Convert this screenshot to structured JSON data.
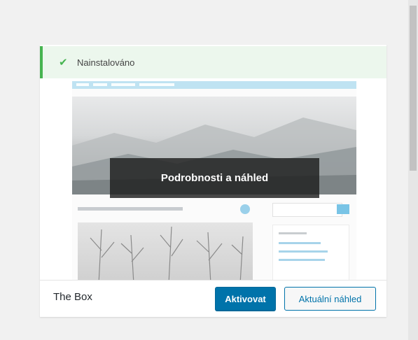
{
  "notice": {
    "text": "Nainstalováno",
    "icon": "check-icon",
    "color": "#46b450"
  },
  "screenshot": {
    "overlay_label": "Podrobnosti a náhled"
  },
  "footer": {
    "theme_name": "The Box",
    "activate_label": "Aktivovat",
    "preview_label": "Aktuální náhled"
  },
  "colors": {
    "accent": "#0073aa",
    "success": "#46b450"
  }
}
